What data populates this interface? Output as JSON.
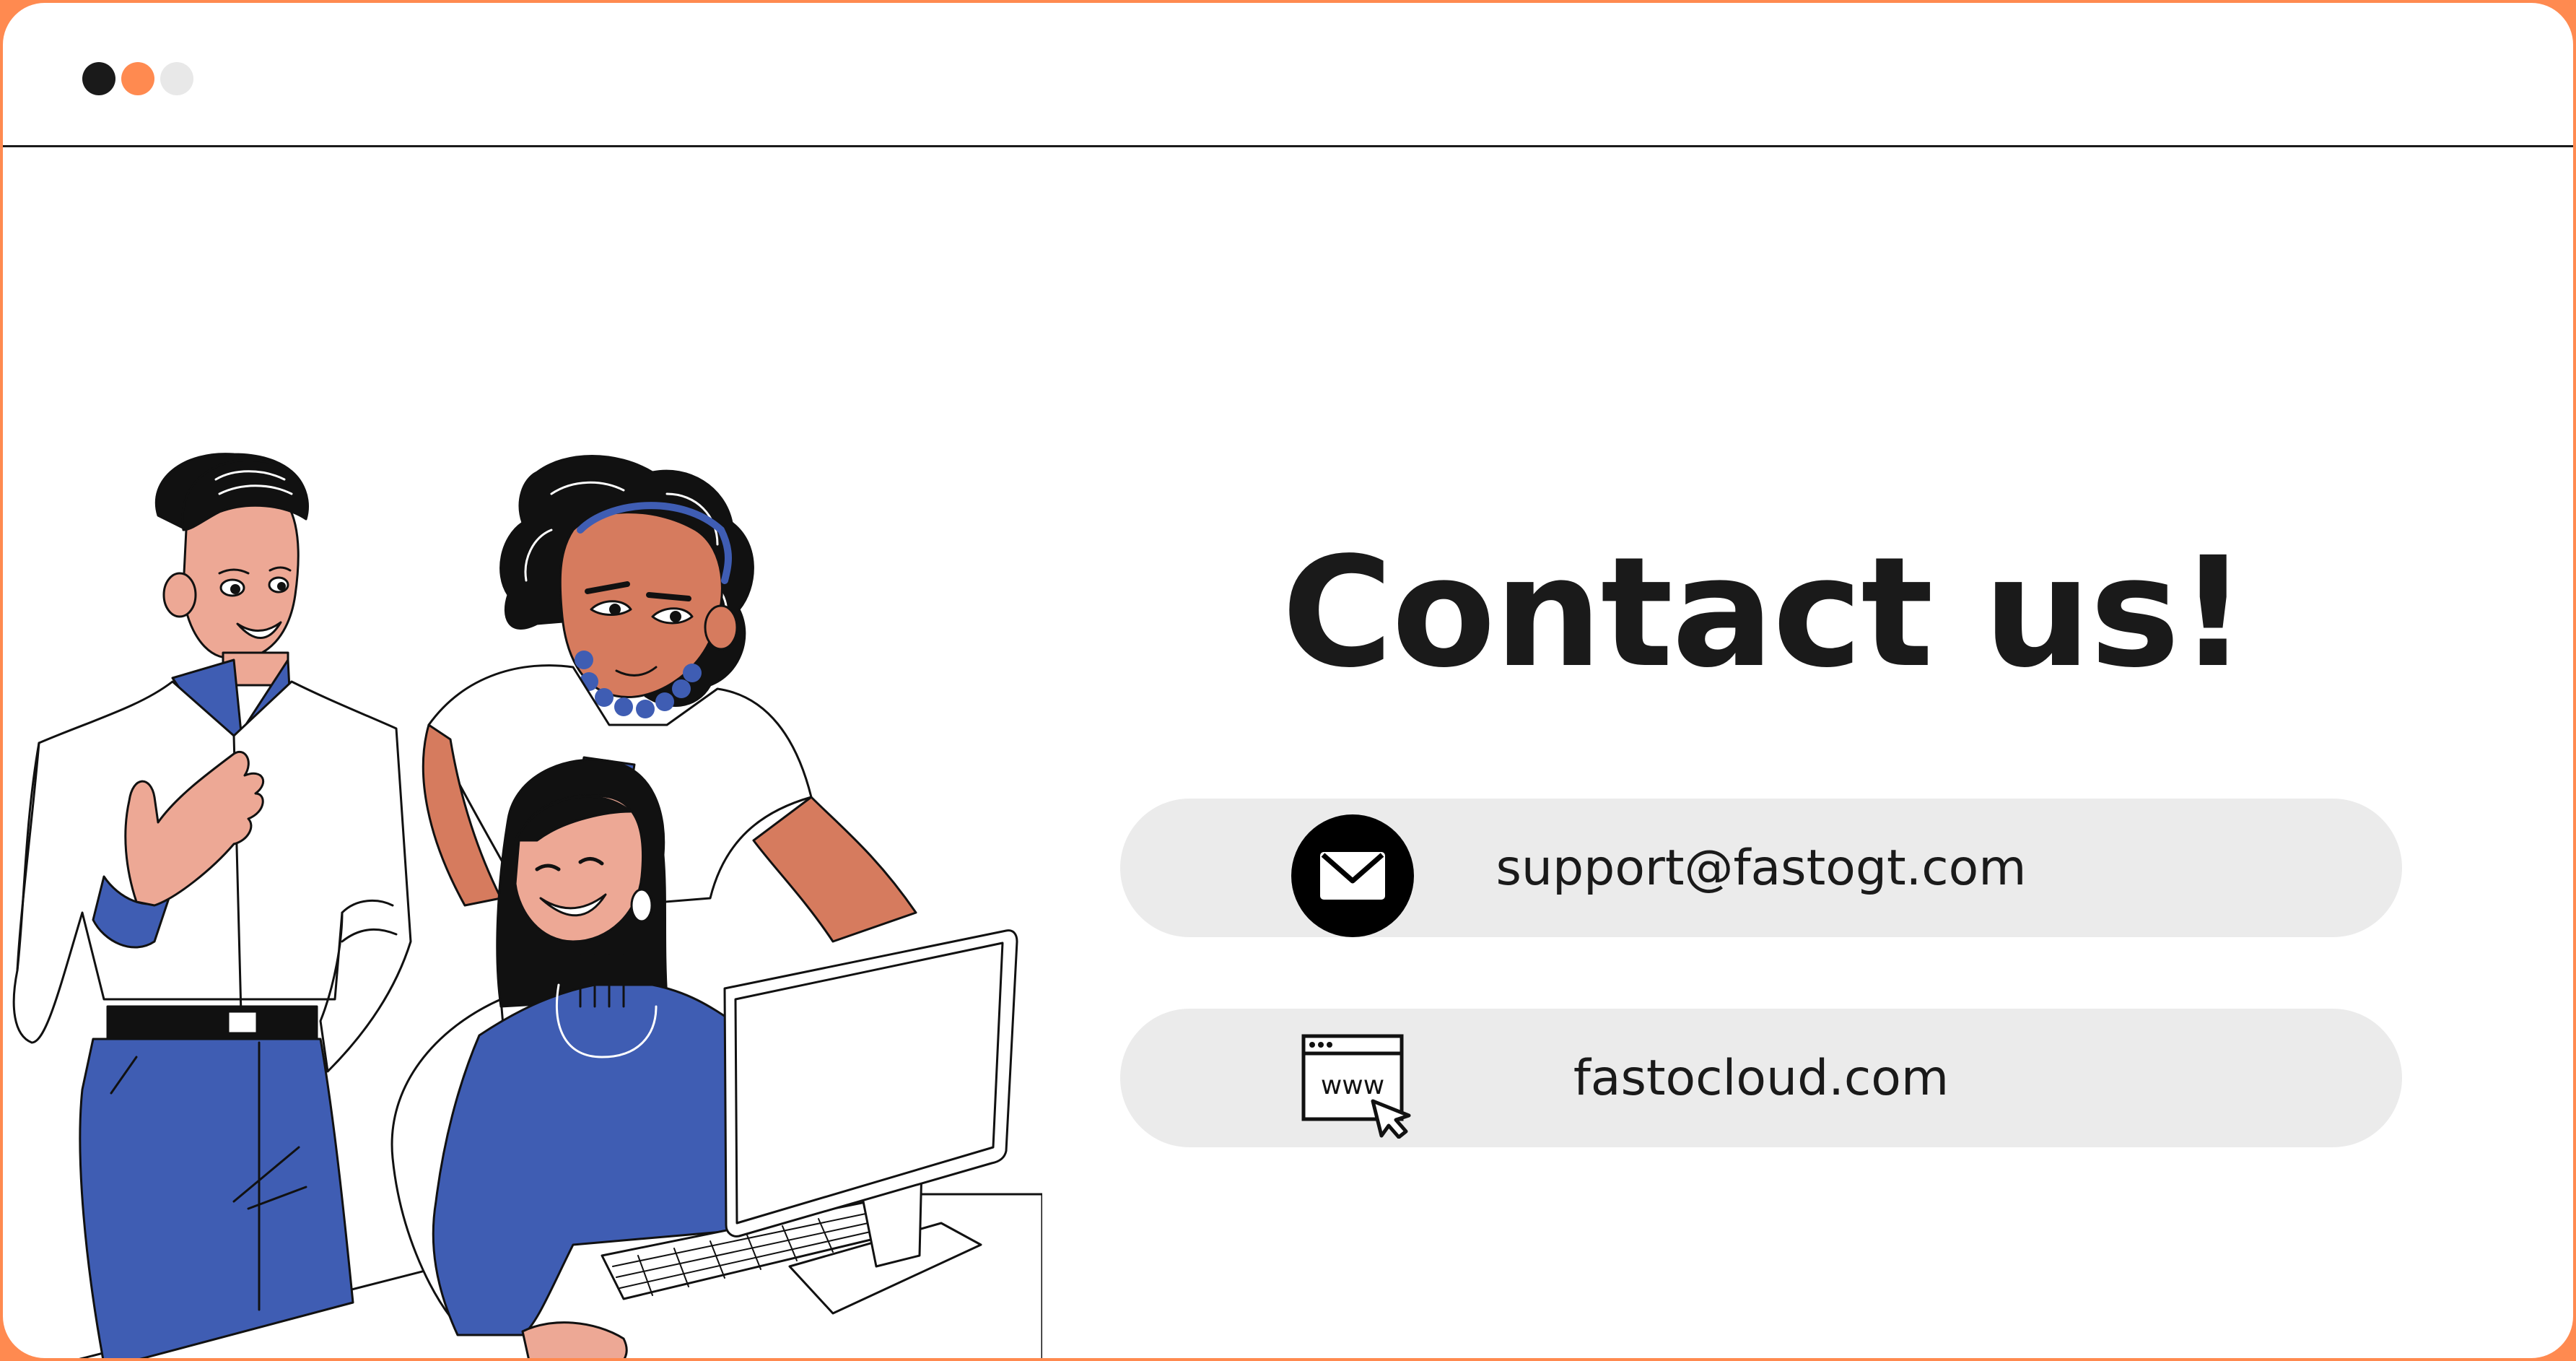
{
  "window": {
    "controls": [
      {
        "name": "close",
        "color": "#1A1A1A"
      },
      {
        "name": "minimize",
        "color": "#FF8A50"
      },
      {
        "name": "maximize",
        "color": "#E8E8E8"
      }
    ]
  },
  "main": {
    "title": "Contact us!",
    "contacts": [
      {
        "type": "email",
        "icon": "envelope-icon",
        "text": "support@fastogt.com"
      },
      {
        "type": "website",
        "icon": "www-browser-icon",
        "text": "fastocloud.com"
      }
    ]
  },
  "colors": {
    "accent": "#FF8A50",
    "text": "#1A1A1A",
    "pill": "#EBEBEB",
    "illustration_blue": "#3F5DB3",
    "skin_light": "#EDA895",
    "skin_dark": "#D67B5E"
  }
}
